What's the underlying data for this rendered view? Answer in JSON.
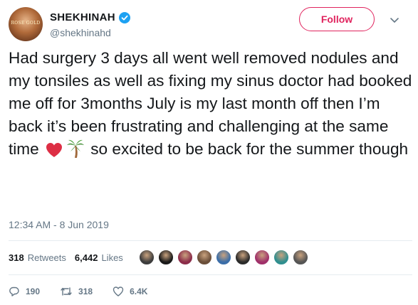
{
  "user": {
    "display_name": "SHEKHINAH",
    "handle": "@shekhinahd",
    "avatar_caption": "ROSE GOLD",
    "verified": true
  },
  "follow_button": {
    "label": "Follow"
  },
  "tweet": {
    "text_before_emoji": "Had surgery 3 days all went well removed nodules and my tonsiles as well as fixing my sinus doctor had booked me off for 3months July is my last month off then I’m back it’s been frustrating and challenging at the same time",
    "emojis": [
      "heart-emoji",
      "palm-tree-emoji"
    ],
    "text_after_emoji": "so excited to be back for the summer though",
    "timestamp": "12:34 AM - 8 Jun 2019"
  },
  "stats": {
    "retweets_count": "318",
    "retweets_label": "Retweets",
    "likes_count": "6,442",
    "likes_label": "Likes"
  },
  "liker_avatars": [
    "#3d3d3d",
    "#1a1a1a",
    "#8c2d4a",
    "#6b4f3a",
    "#3b6ea8",
    "#2b2b2b",
    "#a0306a",
    "#2f8f8f",
    "#555555"
  ],
  "actions": {
    "replies": "190",
    "retweets": "318",
    "likes": "6.4K"
  },
  "colors": {
    "accent": "#e0245e",
    "verified": "#1da1f2",
    "muted": "#657786"
  }
}
